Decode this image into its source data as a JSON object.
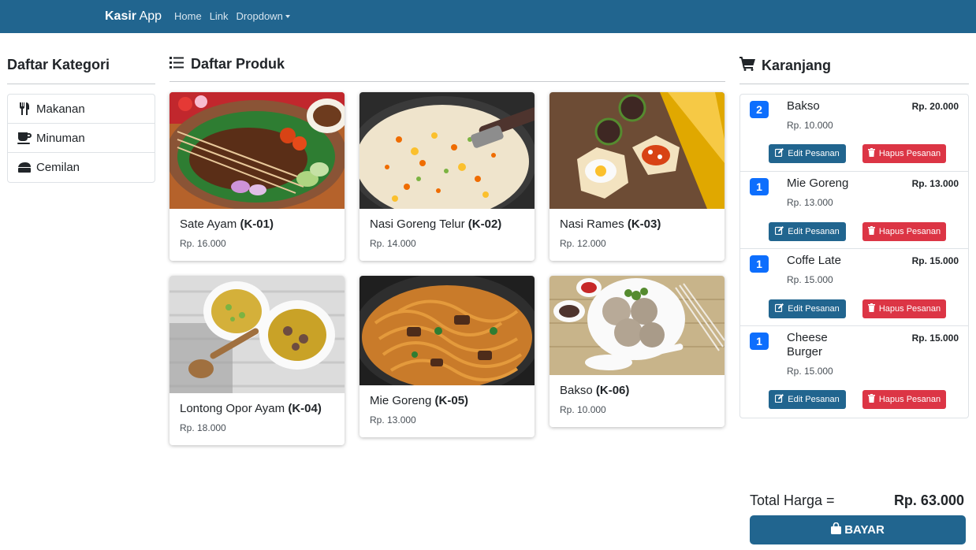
{
  "navbar": {
    "brand_bold": "Kasir",
    "brand_rest": " App",
    "links": [
      "Home",
      "Link",
      "Dropdown"
    ]
  },
  "categories": {
    "title": "Daftar Kategori",
    "items": [
      {
        "label": "Makanan",
        "icon": "utensils-icon"
      },
      {
        "label": "Minuman",
        "icon": "coffee-icon"
      },
      {
        "label": "Cemilan",
        "icon": "cheese-icon"
      }
    ]
  },
  "products": {
    "title": "Daftar Produk",
    "items": [
      {
        "name": "Sate Ayam",
        "code": "(K-01)",
        "price": "Rp. 16.000",
        "photo": "sate-ayam"
      },
      {
        "name": "Nasi Goreng Telur",
        "code": "(K-02)",
        "price": "Rp. 14.000",
        "photo": "nasi-goreng"
      },
      {
        "name": "Nasi Rames",
        "code": "(K-03)",
        "price": "Rp. 12.000",
        "photo": "nasi-rames"
      },
      {
        "name": "Lontong Opor Ayam",
        "code": "(K-04)",
        "price": "Rp. 18.000",
        "photo": "lontong-opor"
      },
      {
        "name": "Mie Goreng",
        "code": "(K-05)",
        "price": "Rp. 13.000",
        "photo": "mie-goreng"
      },
      {
        "name": "Bakso",
        "code": "(K-06)",
        "price": "Rp. 10.000",
        "photo": "bakso"
      }
    ]
  },
  "cart": {
    "title": "Karanjang",
    "edit_label": "Edit Pesanan",
    "delete_label": "Hapus Pesanan",
    "items": [
      {
        "qty": "2",
        "name": "Bakso",
        "price": "Rp. 10.000",
        "total": "Rp. 20.000"
      },
      {
        "qty": "1",
        "name": "Mie Goreng",
        "price": "Rp. 13.000",
        "total": "Rp. 13.000"
      },
      {
        "qty": "1",
        "name": "Coffe Late",
        "price": "Rp. 15.000",
        "total": "Rp. 15.000"
      },
      {
        "qty": "1",
        "name": "Cheese Burger",
        "price": "Rp. 15.000",
        "total": "Rp. 15.000"
      }
    ],
    "total_label": "Total Harga =",
    "total_value": "Rp. 63.000",
    "pay_label": "BAYAR"
  },
  "colors": {
    "primary": "#21658f",
    "danger": "#dc3545",
    "badge": "#0d6efd"
  }
}
